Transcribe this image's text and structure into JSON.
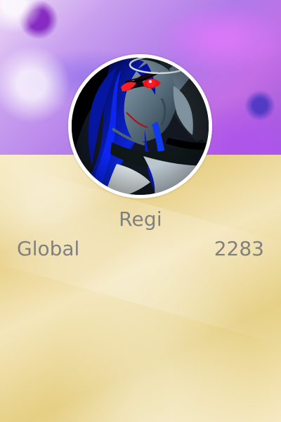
{
  "profile": {
    "name": "Regi",
    "avatar_icon": "profile-avatar",
    "stats": [
      {
        "label": "Global",
        "value": "2283"
      }
    ]
  },
  "colors": {
    "banner_purple": "#b07ae8",
    "banner_magenta": "#c36ee5",
    "gold_background": "#e7cf85",
    "text_gray": "#808080",
    "avatar_border": "#ffffff"
  }
}
